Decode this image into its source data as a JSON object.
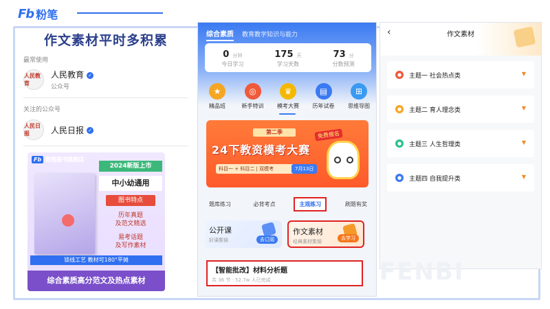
{
  "brand": {
    "logo_latin": "Fb",
    "logo_cn": "粉笔"
  },
  "left": {
    "title": "作文素材平时多积累",
    "recent_label": "最常使用",
    "recent_account": {
      "name": "人民教育",
      "type": "公众号",
      "avatar_text": "人民教育"
    },
    "follow_label": "关注的公众号",
    "follow_account": {
      "name": "人民日报",
      "avatar_text": "人民日报"
    },
    "book": {
      "store": "粉笔图书旗舰店",
      "store_logo": "Fb",
      "new_label": "2024新版上市",
      "scope": "中小幼通用",
      "feature_title": "图书特点",
      "feature_1a": "历年真题",
      "feature_1b": "及范文精选",
      "feature_2a": "易考话题",
      "feature_2b": "及写作素材",
      "binding": "锁线工艺  教材可180°平摊",
      "product": "综合素质高分范文及热点素材"
    }
  },
  "middle": {
    "tab_active": "综合素质",
    "tab_other": "教育教学知识与能力",
    "stats": [
      {
        "num": "0",
        "unit": "分钟",
        "label": "今日学习"
      },
      {
        "num": "175",
        "unit": "天",
        "label": "学习天数"
      },
      {
        "num": "73",
        "unit": "分",
        "label": "分数预测"
      }
    ],
    "icons": [
      {
        "label": "精品班",
        "glyph": "★",
        "color": "#f5a623"
      },
      {
        "label": "新手特训",
        "glyph": "◎",
        "color": "#ef5a3a"
      },
      {
        "label": "模考大赛",
        "glyph": "♛",
        "color": "#f5b800"
      },
      {
        "label": "历年试卷",
        "glyph": "▤",
        "color": "#3a7af2"
      },
      {
        "label": "思维导图",
        "glyph": "⊞",
        "color": "#3a9af2"
      }
    ],
    "banner": {
      "season": "第二季",
      "title": "24下教资模考大赛",
      "tag": "免费报名",
      "info": "科目一 + 科目二 | 双模考",
      "date": "7月13日"
    },
    "segments": [
      "题库练习",
      "必背考点",
      "主观练习",
      "刷题有奖"
    ],
    "active_segment": 2,
    "card_left": {
      "title": "公开课",
      "sub": "好课集锦",
      "btn": "去订阅"
    },
    "card_right": {
      "title": "作文素材",
      "sub": "经典素材集锦",
      "btn": "去学习"
    },
    "practice": {
      "title": "【智能批改】材料分析题",
      "meta": "共 36 节 · 52.7w 人已完成"
    }
  },
  "right": {
    "title": "作文素材",
    "topics": [
      {
        "label": "主题一 社会热点类",
        "color": "#ef5a3a"
      },
      {
        "label": "主题二 育人理念类",
        "color": "#f5a623"
      },
      {
        "label": "主题三 人生哲理类",
        "color": "#2fbf8f"
      },
      {
        "label": "主题四 自我提升类",
        "color": "#3a7af2"
      }
    ],
    "watermark": "FENBI"
  }
}
